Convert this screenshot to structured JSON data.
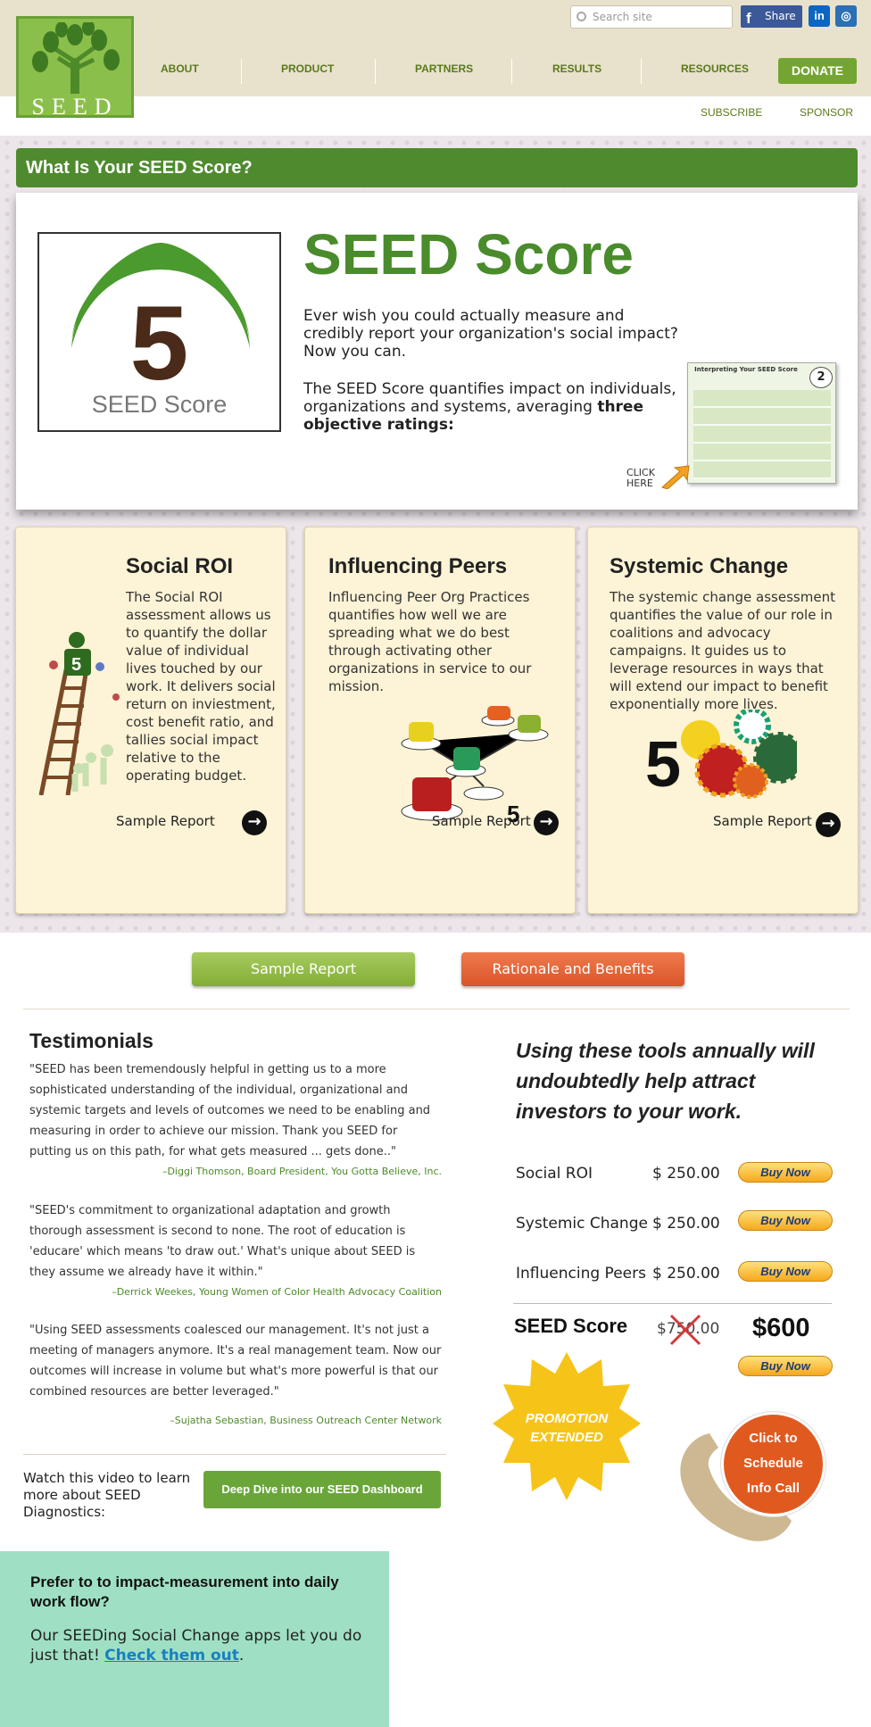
{
  "header": {
    "logo_text": "SEED",
    "search_placeholder": "Search site",
    "share_label": "Share",
    "linkedin_label": "in",
    "instagram_label": "◎",
    "nav": [
      "ABOUT",
      "PRODUCT",
      "PARTNERS",
      "RESULTS",
      "RESOURCES"
    ],
    "donate_label": "DONATE",
    "subscribe_label": "SUBSCRIBE",
    "sponsor_label": "SPONSOR"
  },
  "section_bar": "What Is Your SEED Score?",
  "hero": {
    "badge_number": "5",
    "badge_label": "SEED Score",
    "title": "SEED Score",
    "paragraph1": "Ever wish you could actually measure and credibly report your organization's social impact? Now you can.",
    "paragraph2_lead": "The SEED Score quantifies impact on individuals, organizations and systems, averaging ",
    "paragraph2_bold": "three objective ratings:",
    "thumb_title": "Interpreting Your SEED Score",
    "thumb_badge": "2",
    "click_here": "CLICK HERE"
  },
  "cards": [
    {
      "title": "Social ROI",
      "text": "The Social ROI assessment allows us to quantify the dollar value of individual lives touched by our work. It delivers social return on inviestment, cost benefit ratio, and tallies social impact relative to the operating budget.",
      "figure_number": "5",
      "sample": "Sample Report"
    },
    {
      "title": "Influencing Peers",
      "text": "Influencing Peer Org Practices quantifies how well we are spreading what we do best through activating other organizations in service to our mission.",
      "figure_number": "5",
      "sample": "Sample Report"
    },
    {
      "title": "Systemic Change",
      "text": "The systemic change assessment quantifies the value of our role in coalitions and advocacy campaigns. It guides us to leverage resources in ways that will extend our impact to benefit exponentially more lives.",
      "figure_number": "5",
      "sample": "Sample Report"
    }
  ],
  "buttons": {
    "sample_report": "Sample Report",
    "rationale": "Rationale and Benefits"
  },
  "testimonials": {
    "heading": "Testimonials",
    "items": [
      {
        "quote": "\"SEED has been tremendously helpful in getting us to a more sophisticated understanding of the individual, organizational and systemic targets and levels of outcomes we need to be enabling and measuring in order to achieve our mission. Thank you SEED for putting us on this path, for what gets measured ... gets done..\"",
        "author": "–Diggi Thomson, Board President, You Gotta Believe, Inc."
      },
      {
        "quote": "\"SEED's commitment to organizational adaptation and growth thorough assessment is second to none.  The root of education is 'educare' which means 'to draw out.'  What's unique about SEED is they assume we already have it within.\"",
        "author": "–Derrick Weekes, Young Women of Color Health Advocacy Coalition"
      },
      {
        "quote": "\"Using SEED assessments coalesced our management.  It's not just a meeting of managers anymore. It's a real management team.  Now our outcomes will increase in volume but what's more powerful is that our combined resources are better leveraged.\"",
        "author": "–Sujatha Sebastian, Business Outreach Center Network"
      }
    ]
  },
  "video": {
    "text": "Watch this video to learn more about SEED Diagnostics:",
    "button": "Deep Dive into our SEED Dashboard"
  },
  "apps": {
    "heading": "Prefer to to impact-measurement into daily work flow?",
    "text": "Our SEEDing Social Change apps let you do just that!  ",
    "link": "Check them out",
    "tail": "."
  },
  "pricing": {
    "tagline": "Using these tools annually will undoubtedly help attract investors to your work.",
    "rows": [
      {
        "name": "Social ROI",
        "price": "$ 250.00",
        "buy": "Buy Now"
      },
      {
        "name": "Systemic Change",
        "price": "$ 250.00",
        "buy": "Buy Now"
      },
      {
        "name": "Influencing Peers",
        "price": "$ 250.00",
        "buy": "Buy Now"
      }
    ],
    "bundle_name": "SEED Score",
    "bundle_old": "$750.00",
    "bundle_new": "$600",
    "bundle_buy": "Buy Now",
    "promo": "PROMOTION EXTENDED",
    "call": "Click to Schedule Info Call"
  },
  "colors": {
    "brand_green": "#4e8b2e",
    "accent_orange": "#e05a20",
    "card_bg": "#fdf3d6"
  }
}
